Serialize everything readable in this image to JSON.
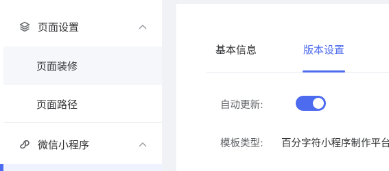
{
  "sidebar": {
    "groups": [
      {
        "label": "页面设置",
        "icon": "layers-icon",
        "expanded": true,
        "items": [
          {
            "label": "页面装修",
            "active": true
          },
          {
            "label": "页面路径",
            "active": false
          }
        ]
      },
      {
        "label": "微信小程序",
        "icon": "mini-program-icon",
        "expanded": true,
        "items": []
      }
    ]
  },
  "main": {
    "tabs": [
      {
        "label": "基本信息",
        "active": false
      },
      {
        "label": "版本设置",
        "active": true
      }
    ],
    "form": {
      "auto_update_label": "自动更新:",
      "auto_update_on": true,
      "template_type_label": "模板类型:",
      "template_type_value": "百分字符小程序制作平台"
    }
  },
  "colors": {
    "accent": "#4d6bef",
    "page_bg": "#f0f2f5",
    "active_item_bg": "#f5f7fa"
  }
}
